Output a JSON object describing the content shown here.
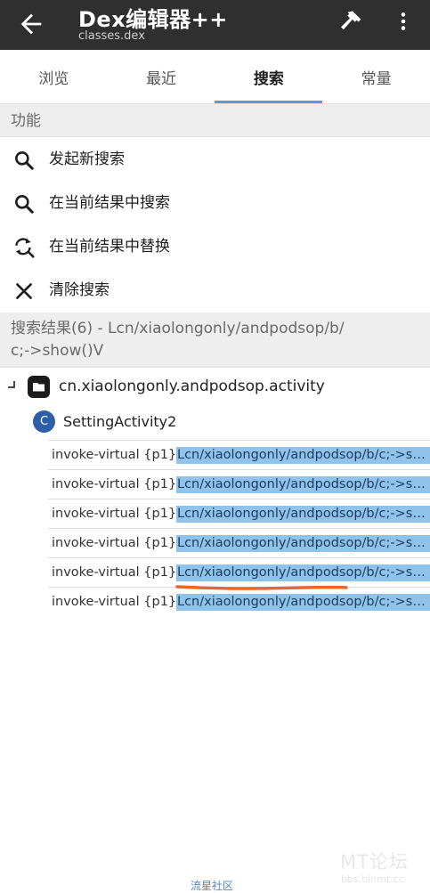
{
  "appbar": {
    "title": "Dex编辑器++",
    "subtitle": "classes.dex",
    "icons": [
      "back-arrow-icon",
      "hammer-icon",
      "more-vert-icon"
    ]
  },
  "tabs": [
    {
      "label": "浏览",
      "active": false
    },
    {
      "label": "最近",
      "active": false
    },
    {
      "label": "搜索",
      "active": true
    },
    {
      "label": "常量",
      "active": false
    }
  ],
  "functions": {
    "header": "功能",
    "items": [
      {
        "label": "发起新搜索",
        "icon": "search-icon"
      },
      {
        "label": "在当前结果中搜索",
        "icon": "search-icon"
      },
      {
        "label": "在当前结果中替换",
        "icon": "replace-icon"
      },
      {
        "label": "清除搜索",
        "icon": "close-icon"
      }
    ]
  },
  "results": {
    "header_line1": "搜索结果(6) - Lcn/xiaolongonly/andpodsop/b/",
    "header_line2": "c;->show()V",
    "package": "cn.xiaolongonly.andpodsop.activity",
    "class_badge": "C",
    "class_name": "SettingActivity2",
    "rows": [
      {
        "prefix": "invoke-virtual {p1},",
        "match": "Lcn/xiaolongonly/andpodsop/b/c;->sh..."
      },
      {
        "prefix": "invoke-virtual {p1},",
        "match": "Lcn/xiaolongonly/andpodsop/b/c;->sh..."
      },
      {
        "prefix": "invoke-virtual {p1},",
        "match": "Lcn/xiaolongonly/andpodsop/b/c;->sh..."
      },
      {
        "prefix": "invoke-virtual {p1},",
        "match": "Lcn/xiaolongonly/andpodsop/b/c;->sh..."
      },
      {
        "prefix": "invoke-virtual {p1},",
        "match": "Lcn/xiaolongonly/andpodsop/b/c;->sh..."
      },
      {
        "prefix": "invoke-virtual {p1},",
        "match": "Lcn/xiaolongonly/andpodsop/b/c;->sh..."
      }
    ]
  },
  "watermark": {
    "main": "MT论坛",
    "sub": "bbs.binmt.cc",
    "bottom": "流星社区"
  },
  "colors": {
    "appbar_bg": "#2f2f2f",
    "tab_indicator": "#5b9bd5",
    "highlight": "#8fc3ec",
    "class_badge": "#2f5ea8",
    "annotation": "#e8672a"
  }
}
